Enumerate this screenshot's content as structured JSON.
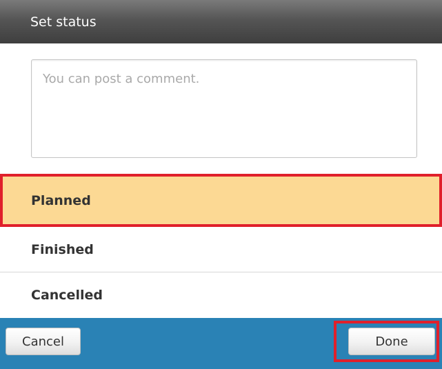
{
  "dialog": {
    "title": "Set status"
  },
  "comment": {
    "placeholder": "You can post a comment.",
    "value": ""
  },
  "statuses": [
    {
      "label": "Planned",
      "selected": true
    },
    {
      "label": "Finished",
      "selected": false
    },
    {
      "label": "Cancelled",
      "selected": false
    }
  ],
  "footer": {
    "cancel_label": "Cancel",
    "done_label": "Done"
  },
  "colors": {
    "header_bg": "#555555",
    "selected_bg": "#fcd994",
    "highlight_border": "#e0202b",
    "footer_bg": "#2a82b5"
  }
}
